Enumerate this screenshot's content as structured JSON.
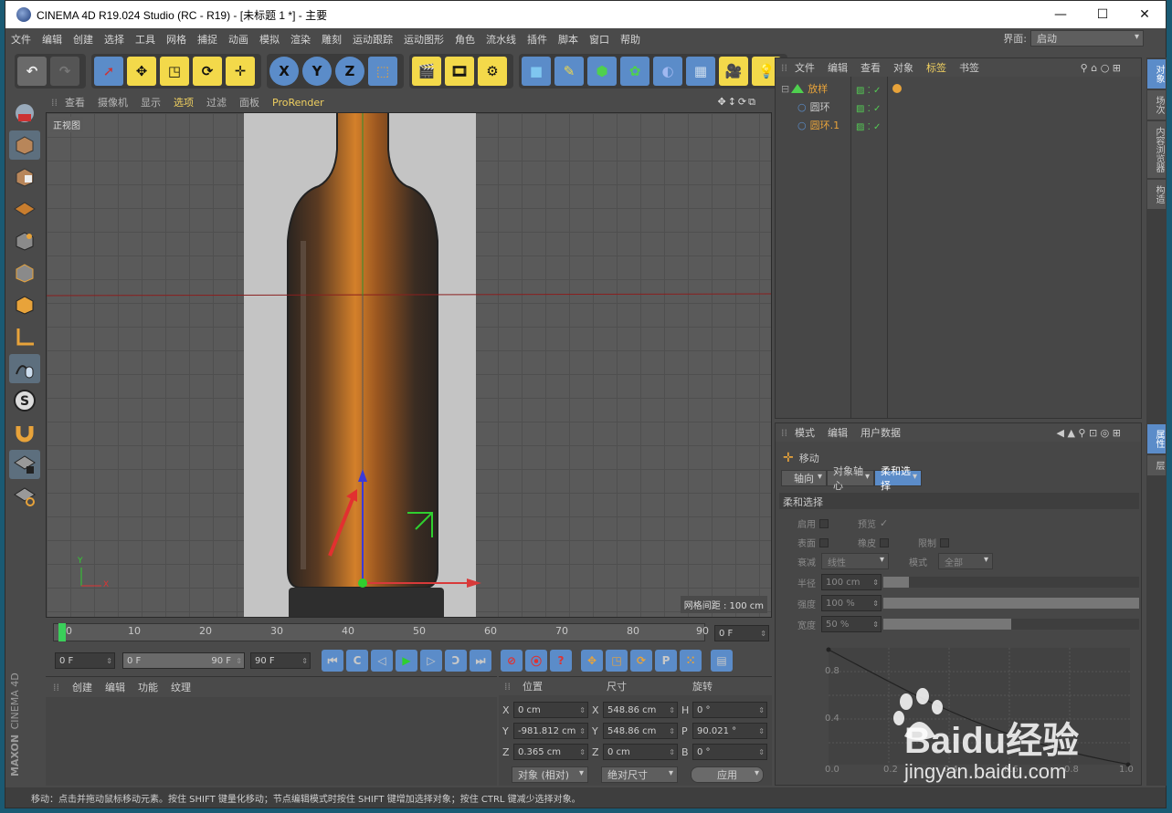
{
  "window": {
    "title": "CINEMA 4D R19.024 Studio (RC - R19) - [未标题 1 *] - 主要",
    "minimize": "—",
    "maximize": "☐",
    "close": "✕"
  },
  "menu": [
    "文件",
    "编辑",
    "创建",
    "选择",
    "工具",
    "网格",
    "捕捉",
    "动画",
    "模拟",
    "渲染",
    "雕刻",
    "运动跟踪",
    "运动图形",
    "角色",
    "流水线",
    "插件",
    "脚本",
    "窗口",
    "帮助"
  ],
  "layout": {
    "label": "界面:",
    "value": "启动"
  },
  "viewport": {
    "menu": [
      "查看",
      "摄像机",
      "显示",
      "选项",
      "过滤",
      "面板",
      "ProRender"
    ],
    "view_name": "正视图",
    "grid_spacing": "网格间距 : 100 cm",
    "axis_y": "Y",
    "axis_x": "X"
  },
  "timeline": {
    "ticks": [
      "0",
      "10",
      "20",
      "30",
      "40",
      "50",
      "60",
      "70",
      "80",
      "90"
    ],
    "current_frame": "0 F"
  },
  "controls": {
    "start": "0 F",
    "range_start": "0 F",
    "range_end": "90 F",
    "end": "90 F"
  },
  "material": {
    "menu": [
      "创建",
      "编辑",
      "功能",
      "纹理"
    ],
    "brand_top": "MAXON",
    "brand_bottom": "CINEMA 4D"
  },
  "coords": {
    "headers": [
      "位置",
      "尺寸",
      "旋转"
    ],
    "rows": [
      {
        "axis": "X",
        "pos": "0 cm",
        "size_axis": "X",
        "size": "548.86 cm",
        "rot_axis": "H",
        "rot": "0 °"
      },
      {
        "axis": "Y",
        "pos": "-981.812 cm",
        "size_axis": "Y",
        "size": "548.86 cm",
        "rot_axis": "P",
        "rot": "90.021 °"
      },
      {
        "axis": "Z",
        "pos": "0.365 cm",
        "size_axis": "Z",
        "size": "0 cm",
        "rot_axis": "B",
        "rot": "0 °"
      }
    ],
    "mode": "对象 (相对)",
    "size_mode": "绝对尺寸",
    "apply": "应用"
  },
  "objects": {
    "menu": [
      "文件",
      "编辑",
      "查看",
      "对象",
      "标签",
      "书签"
    ],
    "items": [
      {
        "name": "放样",
        "color": "#e8a33a",
        "indent": 0
      },
      {
        "name": "圆环",
        "color": "#d8d8d8",
        "indent": 1
      },
      {
        "name": "圆环.1",
        "color": "#e8a33a",
        "indent": 1
      }
    ]
  },
  "attributes": {
    "menu": [
      "模式",
      "编辑",
      "用户数据"
    ],
    "tool": "移动",
    "tabs": [
      "轴向",
      "对象轴心",
      "柔和选择"
    ],
    "section": "柔和选择",
    "enable": "启用",
    "preview": "预览",
    "surface": "表面",
    "rubber": "橡皮",
    "limit": "限制",
    "falloff": "衰减",
    "falloff_value": "线性",
    "mode": "模式",
    "mode_value": "全部",
    "radius": "半径",
    "radius_value": "100 cm",
    "strength": "强度",
    "strength_value": "100 %",
    "width": "宽度",
    "width_value": "50 %",
    "graph_y": [
      "0.8",
      "0.4",
      "0.0"
    ],
    "graph_x": [
      "0.2",
      "0.4",
      "0.6",
      "0.8",
      "1.0"
    ]
  },
  "side_tabs": [
    "对象",
    "场次",
    "内容浏览器",
    "构造"
  ],
  "side_tabs2": [
    "属性",
    "层"
  ],
  "status": "移动：点击并拖动鼠标移动元素。按住 SHIFT 键量化移动；节点编辑模式时按住 SHIFT 键增加选择对象；按住 CTRL 键减少选择对象。",
  "watermark": {
    "brand": "Baidu经验",
    "url": "jingyan.baidu.com"
  },
  "colors": {
    "accent_yellow": "#f3d94a",
    "accent_blue": "#5b8cc9",
    "axis_red": "#d33",
    "axis_green": "#3b3",
    "axis_blue": "#33d"
  }
}
